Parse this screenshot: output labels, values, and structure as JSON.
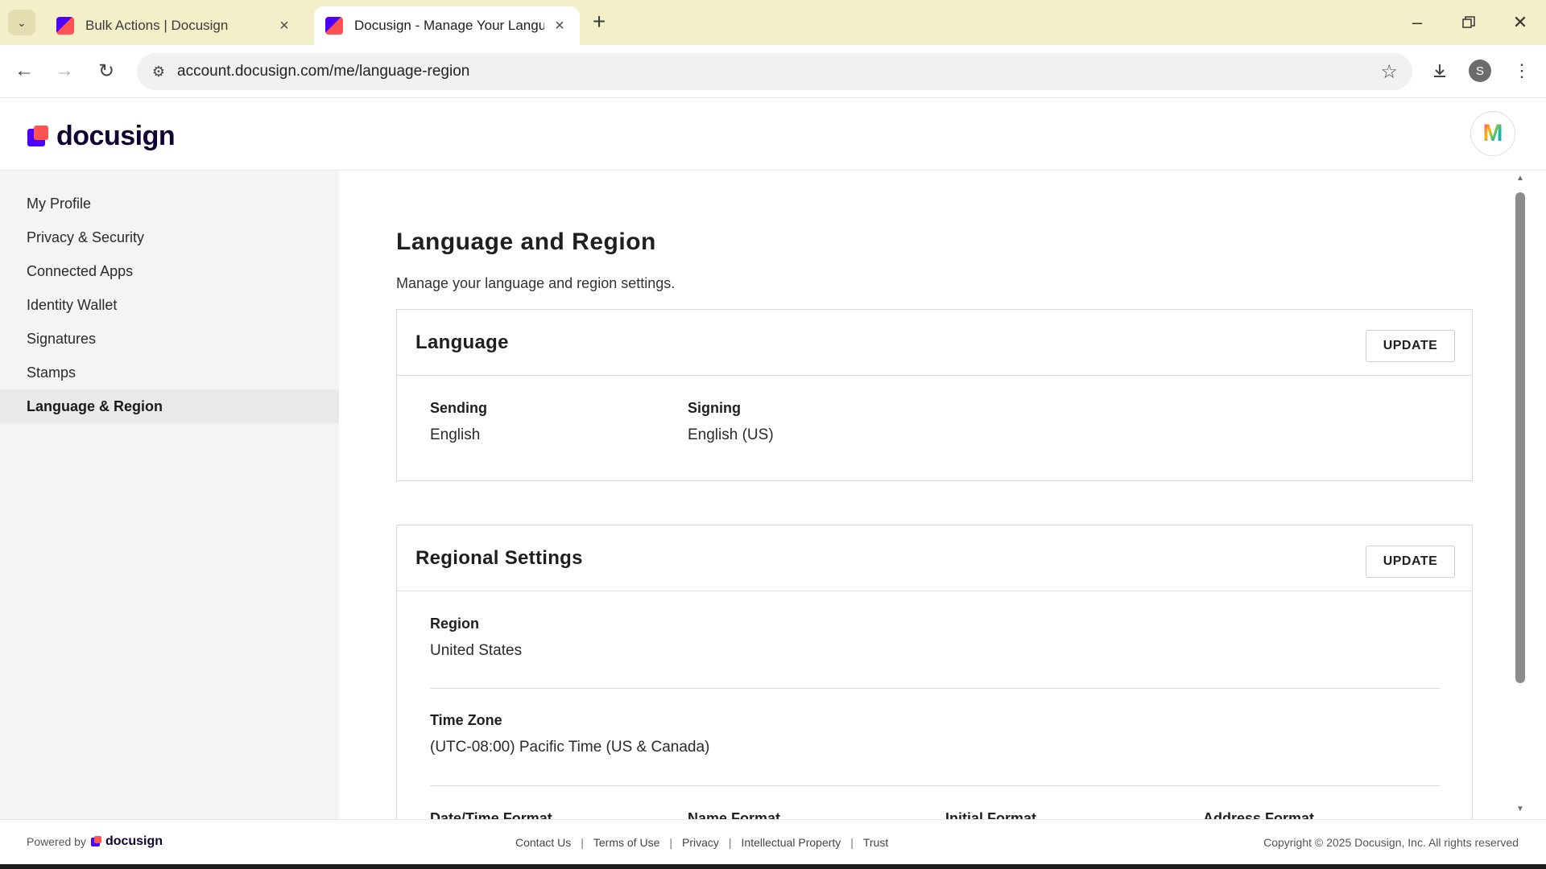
{
  "browser": {
    "tabs": [
      {
        "title": "Bulk Actions | Docusign",
        "active": false
      },
      {
        "title": "Docusign - Manage Your Langu",
        "active": true
      }
    ],
    "url": "account.docusign.com/me/language-region",
    "profile_initial": "S"
  },
  "header": {
    "logo_text": "docusign",
    "avatar_letter": "M"
  },
  "sidebar": {
    "items": [
      {
        "label": "My Profile"
      },
      {
        "label": "Privacy & Security"
      },
      {
        "label": "Connected Apps"
      },
      {
        "label": "Identity Wallet"
      },
      {
        "label": "Signatures"
      },
      {
        "label": "Stamps"
      },
      {
        "label": "Language & Region"
      }
    ],
    "active_index": 6
  },
  "main": {
    "title": "Language and Region",
    "subtitle": "Manage your language and region settings.",
    "language_card": {
      "title": "Language",
      "update_label": "UPDATE",
      "sending_label": "Sending",
      "sending_value": "English",
      "signing_label": "Signing",
      "signing_value": "English (US)"
    },
    "regional_card": {
      "title": "Regional Settings",
      "update_label": "UPDATE",
      "region_label": "Region",
      "region_value": "United States",
      "timezone_label": "Time Zone",
      "timezone_value": "(UTC-08:00) Pacific Time (US & Canada)",
      "format_labels": [
        "Date/Time Format",
        "Name Format",
        "Initial Format",
        "Address Format"
      ]
    }
  },
  "footer": {
    "powered_by": "Powered by",
    "powered_logo": "docusign",
    "links": [
      "Contact Us",
      "Terms of Use",
      "Privacy",
      "Intellectual Property",
      "Trust"
    ],
    "copyright": "Copyright © 2025 Docusign, Inc. All rights reserved"
  },
  "colors": {
    "brand_purple": "#4c00ff",
    "brand_coral": "#ff5252",
    "tabstrip": "#f2efc9"
  }
}
